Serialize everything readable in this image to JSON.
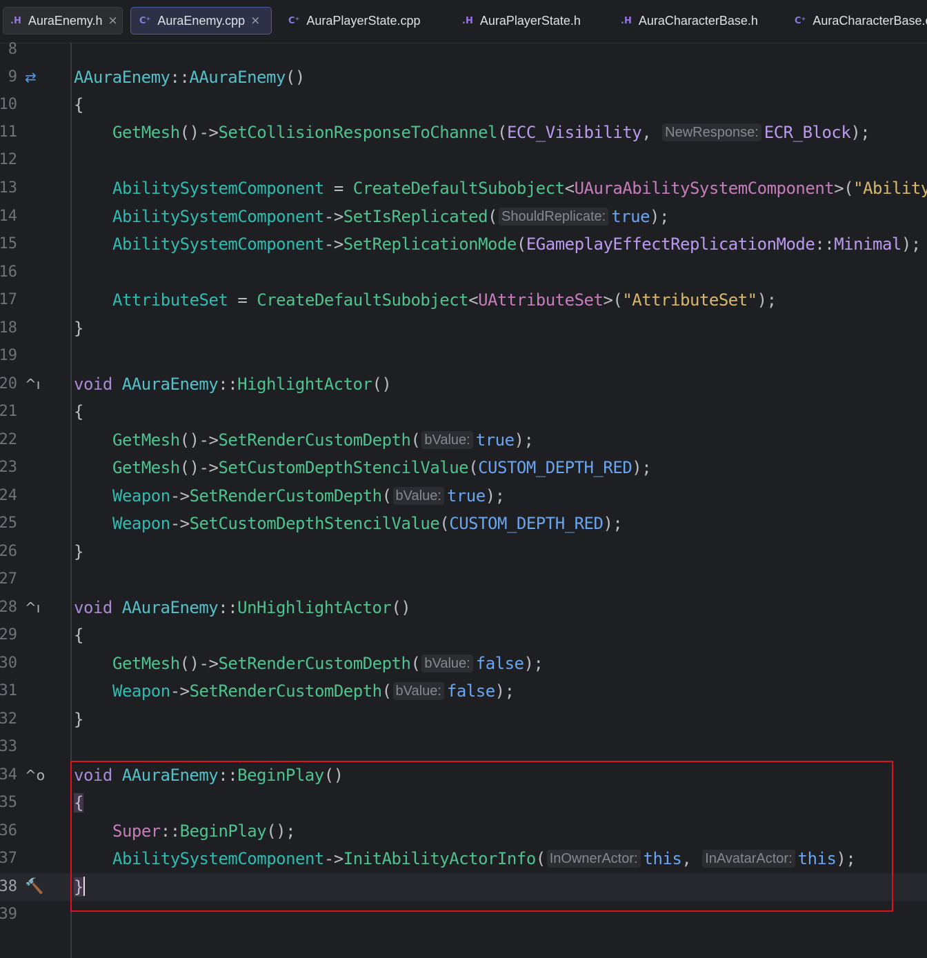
{
  "tabs": [
    {
      "icon": ".H",
      "label": "AuraEnemy.h",
      "close": "×"
    },
    {
      "icon": "C⁺",
      "label": "AuraEnemy.cpp",
      "close": "×"
    },
    {
      "icon": "C⁺",
      "label": "AuraPlayerState.cpp"
    },
    {
      "icon": ".H",
      "label": "AuraPlayerState.h"
    },
    {
      "icon": ".H",
      "label": "AuraCharacterBase.h"
    },
    {
      "icon": "C⁺",
      "label": "AuraCharacterBase.cpp"
    }
  ],
  "gutter_icons": {
    "implements": "⇄",
    "override_up": "^ı",
    "override_circle": "^o",
    "build": "🔨"
  },
  "lines": {
    "n8": "8",
    "n9": "9",
    "n10": "10",
    "n11": "11",
    "n12": "12",
    "n13": "13",
    "n14": "14",
    "n15": "15",
    "n16": "16",
    "n17": "17",
    "n18": "18",
    "n19": "19",
    "n20": "20",
    "n21": "21",
    "n22": "22",
    "n23": "23",
    "n24": "24",
    "n25": "25",
    "n26": "26",
    "n27": "27",
    "n28": "28",
    "n29": "29",
    "n30": "30",
    "n31": "31",
    "n32": "32",
    "n33": "33",
    "n34": "34",
    "n35": "35",
    "n36": "36",
    "n37": "37",
    "n38": "38",
    "n39": "39"
  },
  "code": {
    "l9": {
      "cls": "AAuraEnemy",
      "sep": "::",
      "fn": "AAuraEnemy",
      "rest": "()"
    },
    "open": "{",
    "close": "}",
    "l11": {
      "a": "GetMesh",
      "b": "()->",
      "c": "SetCollisionResponseToChannel",
      "d": "(",
      "e": "ECC_Visibility",
      "f": ", ",
      "hint": "NewResponse:",
      "g": "ECR_Block",
      "h": ");"
    },
    "l13": {
      "a": "AbilitySystemComponent",
      "b": " = ",
      "c": "CreateDefaultSubobject",
      "d": "<",
      "e": "UAuraAbilitySystemComponent",
      "f": ">(",
      "g": "\"Ability"
    },
    "l14": {
      "a": "AbilitySystemComponent",
      "b": "->",
      "c": "SetIsReplicated",
      "d": "(",
      "hint": "ShouldReplicate:",
      "e": "true",
      "f": ");"
    },
    "l15": {
      "a": "AbilitySystemComponent",
      "b": "->",
      "c": "SetReplicationMode",
      "d": "(",
      "e": "EGameplayEffectReplicationMode",
      "f": "::",
      "g": "Minimal",
      "h": ");"
    },
    "l17": {
      "a": "AttributeSet",
      "b": " = ",
      "c": "CreateDefaultSubobject",
      "d": "<",
      "e": "UAttributeSet",
      "f": ">(",
      "g": "\"AttributeSet\"",
      "h": ");"
    },
    "l20": {
      "kw": "void",
      "cls": "AAuraEnemy",
      "sep": "::",
      "fn": "HighlightActor",
      "rest": "()"
    },
    "l22": {
      "a": "GetMesh",
      "b": "()->",
      "c": "SetRenderCustomDepth",
      "d": "(",
      "hint": "bValue:",
      "e": "true",
      "f": ");"
    },
    "l23": {
      "a": "GetMesh",
      "b": "()->",
      "c": "SetCustomDepthStencilValue",
      "d": "(",
      "e": "CUSTOM_DEPTH_RED",
      "f": ");"
    },
    "l24": {
      "a": "Weapon",
      "b": "->",
      "c": "SetRenderCustomDepth",
      "d": "(",
      "hint": "bValue:",
      "e": "true",
      "f": ");"
    },
    "l25": {
      "a": "Weapon",
      "b": "->",
      "c": "SetCustomDepthStencilValue",
      "d": "(",
      "e": "CUSTOM_DEPTH_RED",
      "f": ");"
    },
    "l28": {
      "kw": "void",
      "cls": "AAuraEnemy",
      "sep": "::",
      "fn": "UnHighlightActor",
      "rest": "()"
    },
    "l30": {
      "a": "GetMesh",
      "b": "()->",
      "c": "SetRenderCustomDepth",
      "d": "(",
      "hint": "bValue:",
      "e": "false",
      "f": ");"
    },
    "l31": {
      "a": "Weapon",
      "b": "->",
      "c": "SetRenderCustomDepth",
      "d": "(",
      "hint": "bValue:",
      "e": "false",
      "f": ");"
    },
    "l34": {
      "kw": "void",
      "cls": "AAuraEnemy",
      "sep": "::",
      "fn": "BeginPlay",
      "rest": "()"
    },
    "l36": {
      "a": "Super",
      "b": "::",
      "c": "BeginPlay",
      "d": "();"
    },
    "l37": {
      "a": "AbilitySystemComponent",
      "b": "->",
      "c": "InitAbilityActorInfo",
      "d": "(",
      "hint1": "InOwnerActor:",
      "e": "this",
      "f": ", ",
      "hint2": "InAvatarActor:",
      "g": "this",
      "h": ");"
    }
  },
  "colors": {
    "highlight_box": "#e0101f",
    "background": "#1e1f22"
  }
}
